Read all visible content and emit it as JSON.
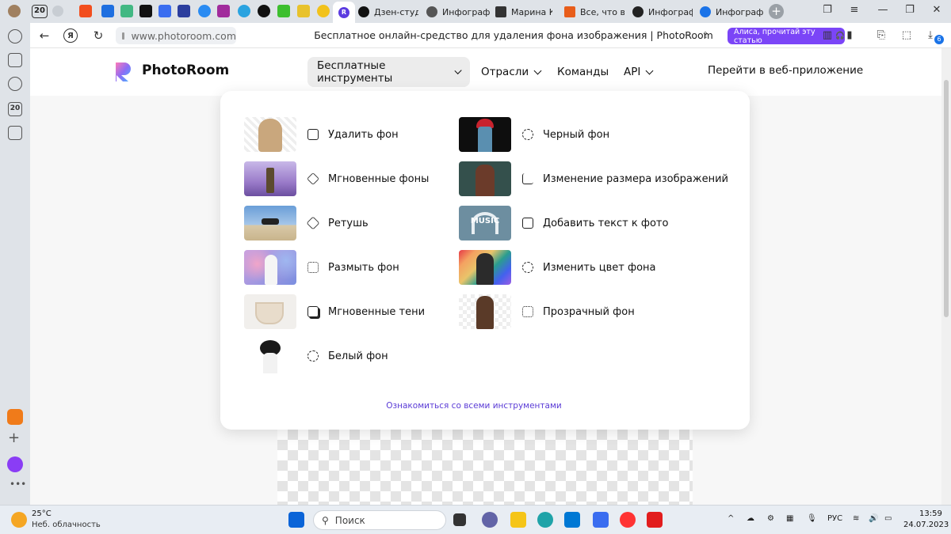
{
  "browser": {
    "tab_count": "20",
    "tabs": [
      {
        "label": "Дзен-студи",
        "color": "#111111"
      },
      {
        "label": "Инфограф",
        "color": "#555555"
      },
      {
        "label": "Марина Ка",
        "color": "#333333"
      },
      {
        "label": "Все, что ва",
        "color": "#e85d1a"
      },
      {
        "label": "Инфограф",
        "color": "#222222"
      },
      {
        "label": "Инфограф",
        "color": "#1a73e8"
      }
    ],
    "url": "www.photoroom.com",
    "page_title": "Бесплатное онлайн-средство для удаления фона изображения | PhotoRoom",
    "alice_button": "Алиса, прочитай эту статью",
    "sidebar_badge": "20",
    "extension_badge": "6"
  },
  "site": {
    "logo": "PhotoRoom",
    "nav": [
      {
        "label": "Бесплатные инструменты",
        "has_chevron": true,
        "active": true
      },
      {
        "label": "Отрасли",
        "has_chevron": true,
        "active": false
      },
      {
        "label": "Команды",
        "has_chevron": false,
        "active": false
      },
      {
        "label": "API",
        "has_chevron": true,
        "active": false
      }
    ],
    "webapp_link": "Перейти в веб-приложение"
  },
  "dropdown": {
    "left_tools": [
      {
        "label": "Удалить фон",
        "icon": "remove-bg-icon"
      },
      {
        "label": "Мгновенные фоны",
        "icon": "layers-icon"
      },
      {
        "label": "Ретушь",
        "icon": "eraser-icon"
      },
      {
        "label": "Размыть фон",
        "icon": "blur-icon"
      },
      {
        "label": "Мгновенные тени",
        "icon": "shadow-icon"
      },
      {
        "label": "Белый фон",
        "icon": "white-bg-icon"
      }
    ],
    "right_tools": [
      {
        "label": "Черный фон",
        "icon": "black-bg-icon"
      },
      {
        "label": "Изменение размера изображений",
        "icon": "crop-icon"
      },
      {
        "label": "Добавить текст к фото",
        "icon": "add-text-icon"
      },
      {
        "label": "Изменить цвет фона",
        "icon": "color-bg-icon"
      },
      {
        "label": "Прозрачный фон",
        "icon": "transparent-bg-icon"
      }
    ],
    "music_thumb_text": "MUSIC",
    "see_all": "Ознакомиться со всеми инструментами"
  },
  "taskbar": {
    "temperature": "25°C",
    "weather": "Неб. облачность",
    "search_placeholder": "Поиск",
    "language": "РУС",
    "time": "13:59",
    "date": "24.07.2023"
  }
}
